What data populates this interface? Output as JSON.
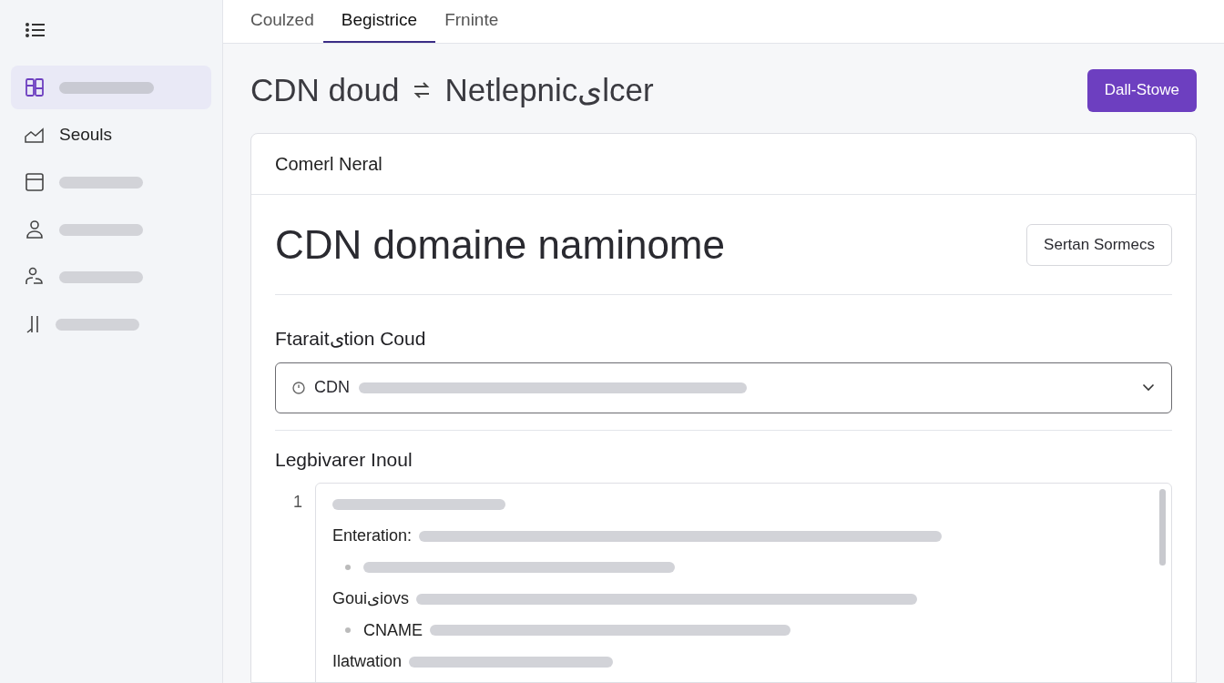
{
  "sidebar": {
    "items": [
      {
        "selected": true
      },
      {
        "label": "Seouls",
        "selected": false
      },
      {
        "selected": false
      },
      {
        "selected": false
      },
      {
        "selected": false
      },
      {
        "selected": false
      }
    ]
  },
  "tabs": [
    {
      "label": "Coulzed",
      "selected": false
    },
    {
      "label": "Begistrice",
      "selected": true
    },
    {
      "label": "Frninte",
      "selected": false
    }
  ],
  "page": {
    "title_left": "CDN doud",
    "title_right": "Netlepnicیlcer",
    "primary_button": "Dall-Stowe"
  },
  "card": {
    "header": "Comerl Neral",
    "heading": "CDN domaine naminome",
    "secondary_button": "Sertan Sormecs",
    "select": {
      "label": "Ftaraitیtion Coud",
      "value": "CDN"
    },
    "editor": {
      "label": "Legbivarer Inoul",
      "line_number": "1",
      "lines": [
        {
          "kind": "text"
        },
        {
          "kind": "text",
          "label": "Enteration:"
        },
        {
          "kind": "bullet"
        },
        {
          "kind": "text",
          "label": "Gouiیiovs"
        },
        {
          "kind": "bullet",
          "label": "CNAME"
        },
        {
          "kind": "text",
          "label": "Ilatwation"
        }
      ]
    }
  }
}
